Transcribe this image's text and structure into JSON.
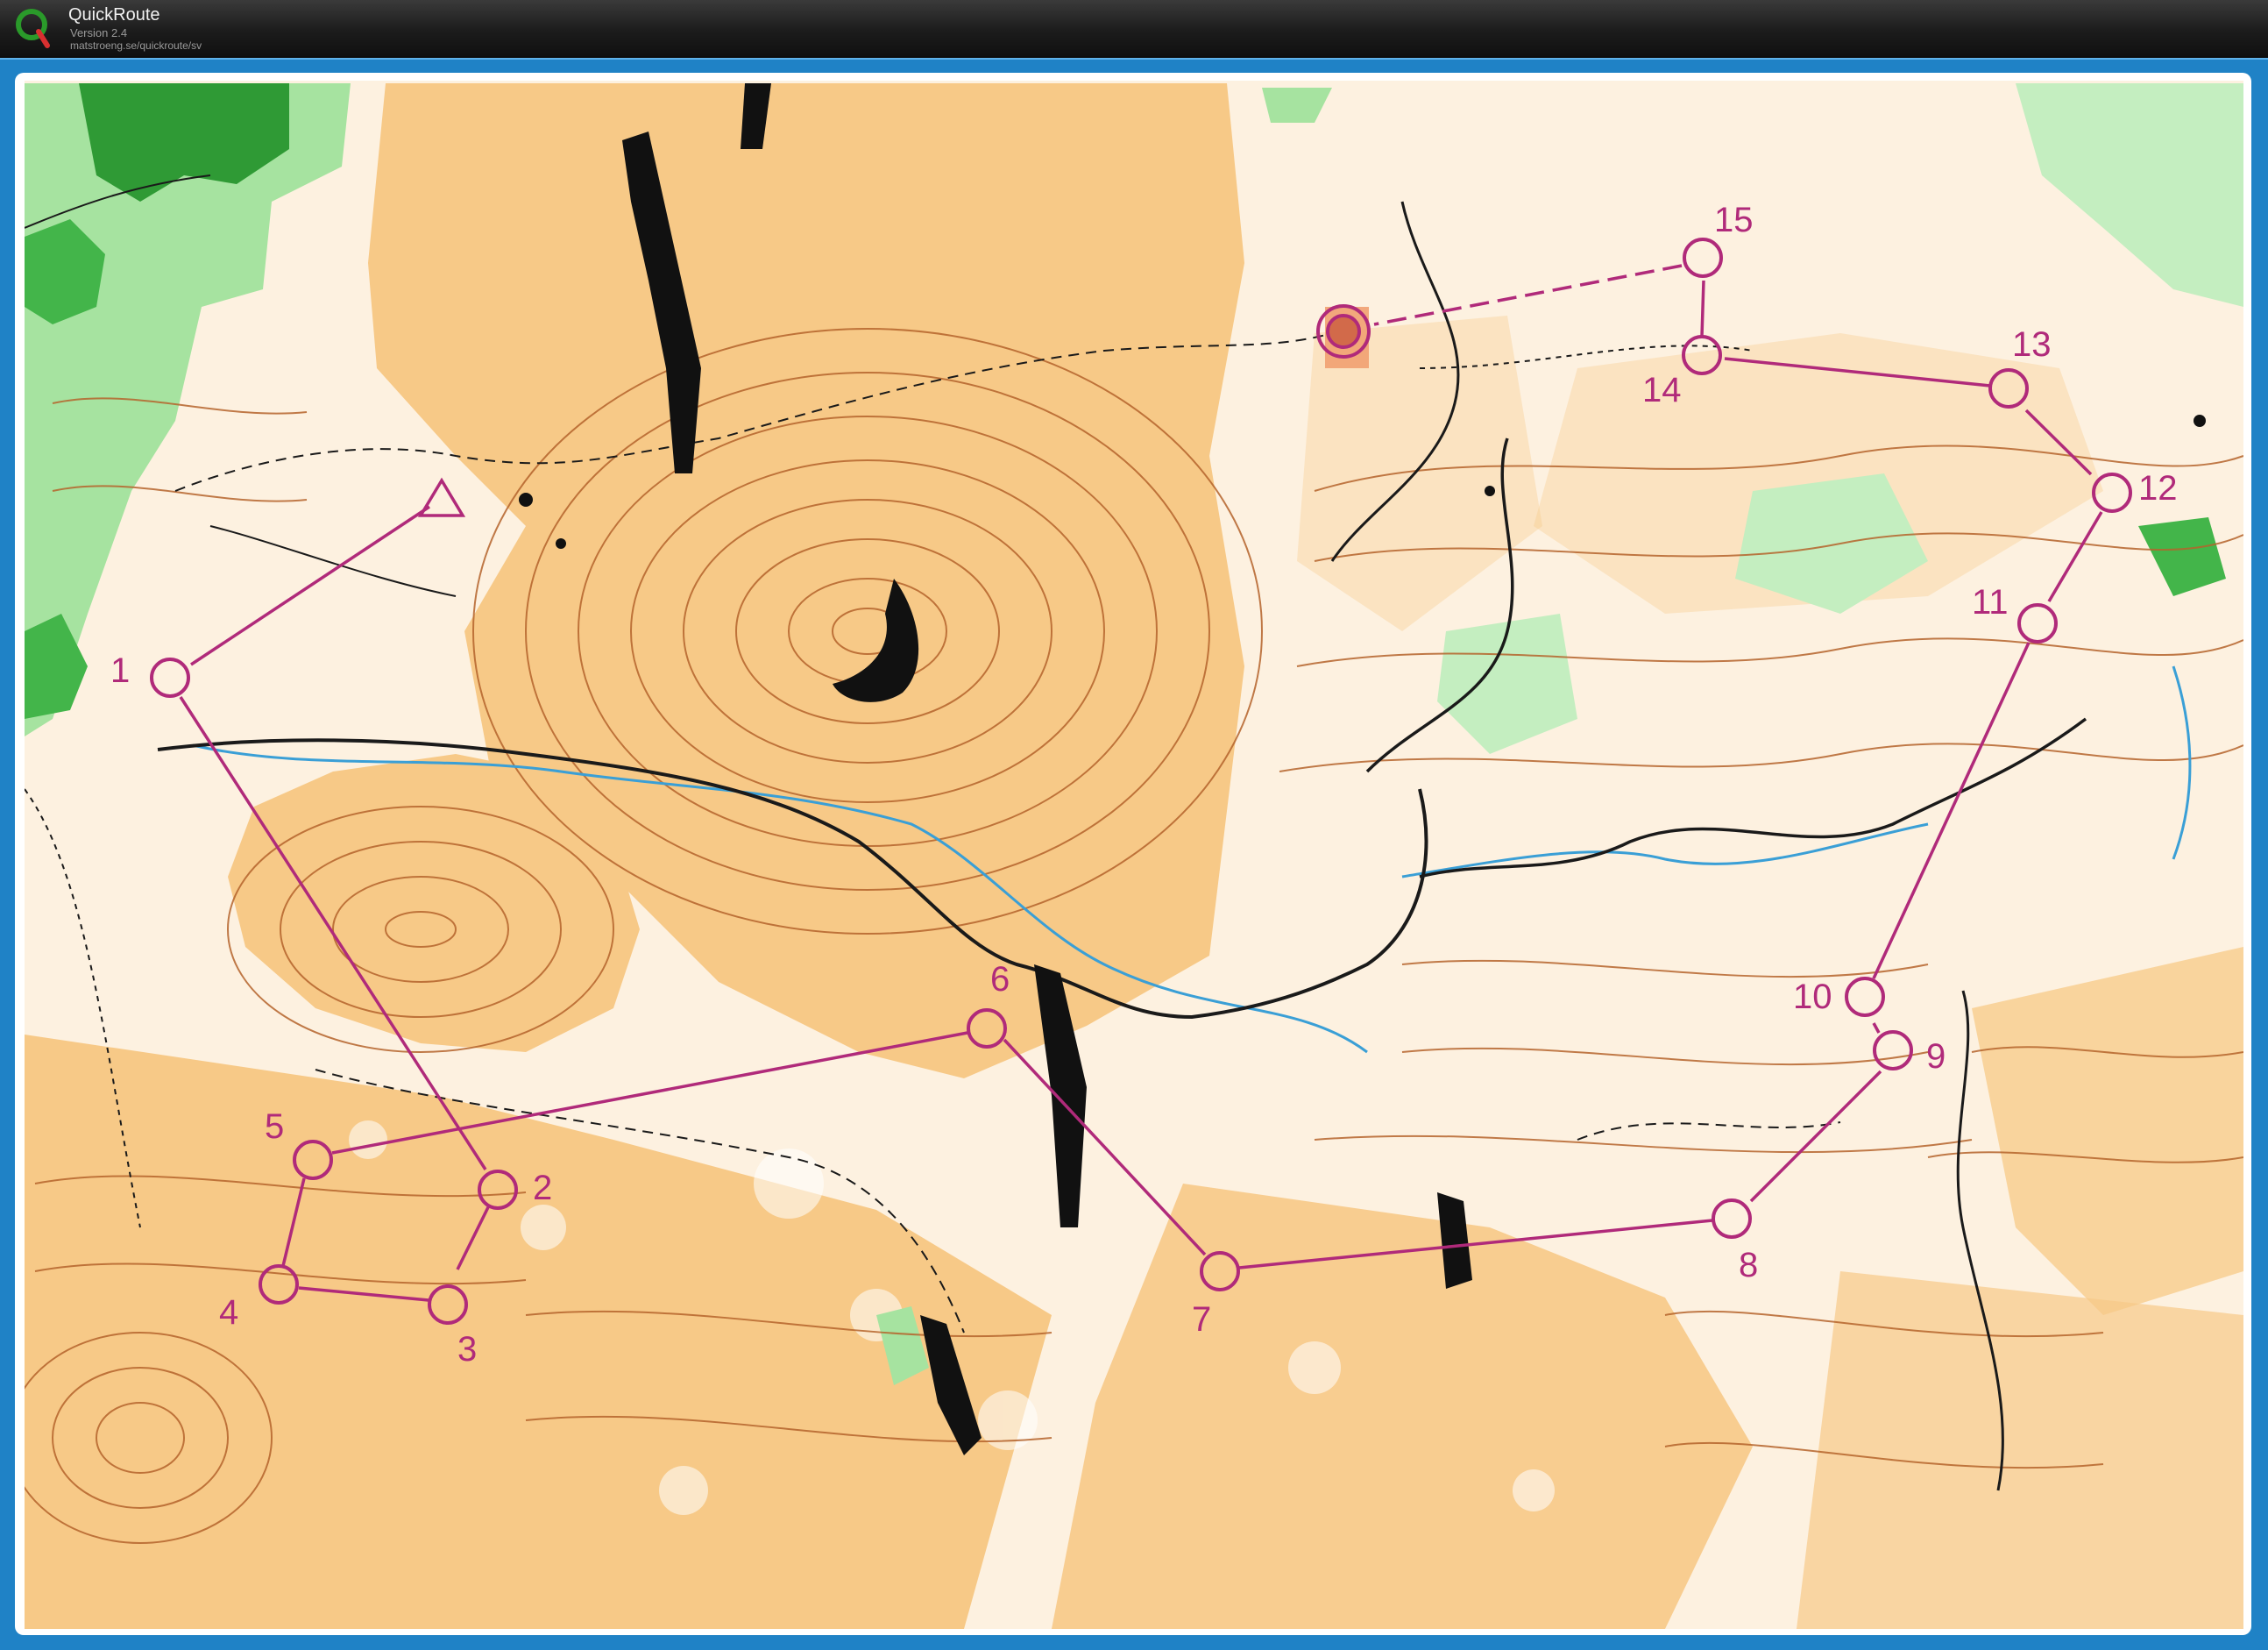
{
  "app": {
    "name": "QuickRoute",
    "version": "Version 2.4",
    "url": "matstroeng.se/quickroute/sv"
  },
  "course": {
    "color": "#b02a7a",
    "start_symbol": "triangle",
    "finish_symbol": "double-circle",
    "controls": [
      "1",
      "2",
      "3",
      "4",
      "5",
      "6",
      "7",
      "8",
      "9",
      "10",
      "11",
      "12",
      "13",
      "14",
      "15"
    ]
  },
  "map": {
    "colors": {
      "open_land": "#f7c987",
      "rough_open": "#fbe0b8",
      "forest_green": "#43b54a",
      "light_green": "#a6e3a0",
      "contour": "#b5642c",
      "path": "#1a1a1a",
      "water": "#3a9fd6"
    }
  }
}
